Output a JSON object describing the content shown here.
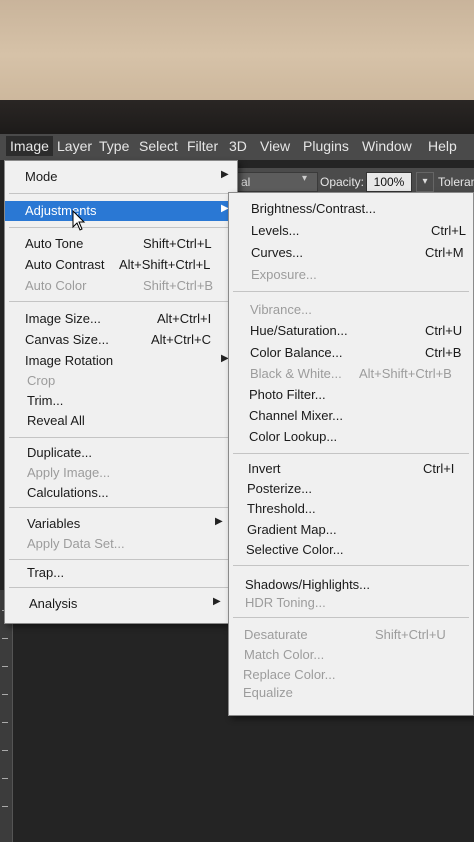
{
  "menubar": [
    "Image",
    "Layer",
    "Type",
    "Select",
    "Filter",
    "3D",
    "View",
    "Plugins",
    "Window",
    "Help"
  ],
  "optionsbar": {
    "blend_value": "al",
    "opacity_label": "Opacity:",
    "opacity_value": "100%",
    "tolerance_label": "Toleran"
  },
  "image_menu": [
    {
      "label": "Mode",
      "submenu": true
    },
    {
      "label": "Adjustments",
      "submenu": true,
      "highlighted": true
    },
    {
      "label": "Auto Tone",
      "shortcut": "Shift+Ctrl+L"
    },
    {
      "label": "Auto Contrast",
      "shortcut": "Alt+Shift+Ctrl+L"
    },
    {
      "label": "Auto Color",
      "shortcut": "Shift+Ctrl+B",
      "disabled": true
    },
    {
      "label": "Image Size...",
      "shortcut": "Alt+Ctrl+I"
    },
    {
      "label": "Canvas Size...",
      "shortcut": "Alt+Ctrl+C"
    },
    {
      "label": "Image Rotation",
      "submenu": true
    },
    {
      "label": "Crop",
      "disabled": true
    },
    {
      "label": "Trim..."
    },
    {
      "label": "Reveal All"
    },
    {
      "label": "Duplicate..."
    },
    {
      "label": "Apply Image...",
      "disabled": true
    },
    {
      "label": "Calculations..."
    },
    {
      "label": "Variables",
      "submenu": true
    },
    {
      "label": "Apply Data Set...",
      "disabled": true
    },
    {
      "label": "Trap..."
    },
    {
      "label": "Analysis",
      "submenu": true
    }
  ],
  "adjustments_menu": [
    {
      "label": "Brightness/Contrast..."
    },
    {
      "label": "Levels...",
      "shortcut": "Ctrl+L"
    },
    {
      "label": "Curves...",
      "shortcut": "Ctrl+M"
    },
    {
      "label": "Exposure...",
      "disabled": true
    },
    {
      "label": "Vibrance...",
      "disabled": true
    },
    {
      "label": "Hue/Saturation...",
      "shortcut": "Ctrl+U"
    },
    {
      "label": "Color Balance...",
      "shortcut": "Ctrl+B"
    },
    {
      "label": "Black & White...",
      "shortcut": "Alt+Shift+Ctrl+B",
      "disabled": true
    },
    {
      "label": "Photo Filter..."
    },
    {
      "label": "Channel Mixer..."
    },
    {
      "label": "Color Lookup..."
    },
    {
      "label": "Invert",
      "shortcut": "Ctrl+I"
    },
    {
      "label": "Posterize..."
    },
    {
      "label": "Threshold..."
    },
    {
      "label": "Gradient Map..."
    },
    {
      "label": "Selective Color..."
    },
    {
      "label": "Shadows/Highlights..."
    },
    {
      "label": "HDR Toning...",
      "disabled": true
    },
    {
      "label": "Desaturate",
      "shortcut": "Shift+Ctrl+U",
      "disabled": true
    },
    {
      "label": "Match Color...",
      "disabled": true
    },
    {
      "label": "Replace Color...",
      "disabled": true
    },
    {
      "label": "Equalize",
      "disabled": true
    }
  ],
  "colors": {
    "highlight": "#2a78d4",
    "menu_bg": "#f0f0f0",
    "disabled_text": "#9c9c9c"
  }
}
